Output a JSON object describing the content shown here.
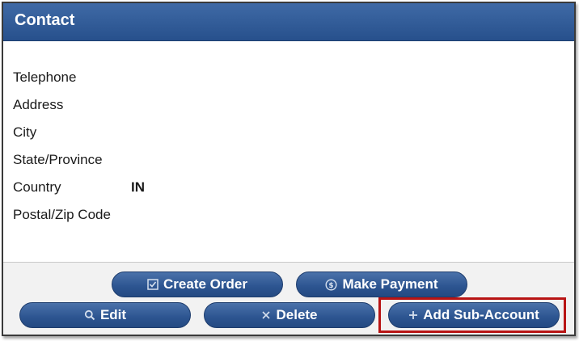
{
  "header": {
    "title": "Contact"
  },
  "fields": [
    {
      "label": "Telephone",
      "value": ""
    },
    {
      "label": "Address",
      "value": ""
    },
    {
      "label": "City",
      "value": ""
    },
    {
      "label": "State/Province",
      "value": ""
    },
    {
      "label": "Country",
      "value": "IN"
    },
    {
      "label": "Postal/Zip Code",
      "value": ""
    }
  ],
  "buttons": {
    "create_order": {
      "label": "Create Order",
      "icon": "checkbox-icon"
    },
    "make_payment": {
      "label": "Make Payment",
      "icon": "dollar-circle-icon"
    },
    "edit": {
      "label": "Edit",
      "icon": "search-icon"
    },
    "delete": {
      "label": "Delete",
      "icon": "close-icon"
    },
    "add_sub_account": {
      "label": "Add Sub-Account",
      "icon": "plus-icon"
    }
  },
  "colors": {
    "header_blue": "#2f5a97",
    "button_blue": "#2c5490",
    "highlight_red": "#b81414"
  }
}
